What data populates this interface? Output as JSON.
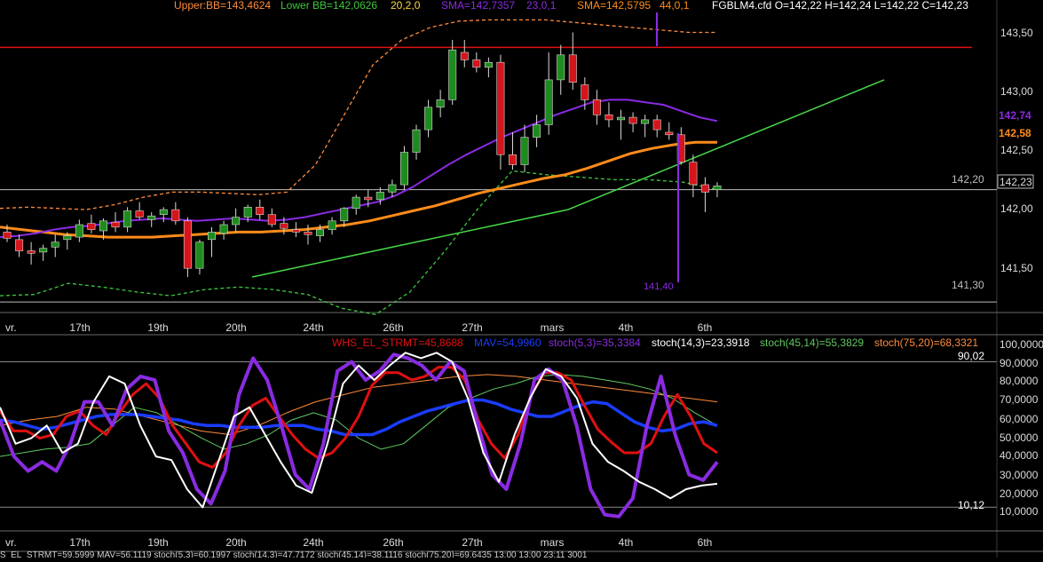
{
  "top_header": {
    "upper_bb": "Upper:BB=143,4624",
    "lower_bb": "Lower BB=142,0626",
    "bb_params": "20,2,0",
    "sma1": "SMA=142,7357",
    "sma1_params": "23,0,1",
    "sma2": "SMA=142,5795",
    "sma2_params": "44,0,1",
    "ohlc": "FGBLM4.cfd O=142,22 H=142,24 L=142,22 C=142,23"
  },
  "bottom_header": {
    "whs": "WHS_EL_STRMT=45,8688",
    "mav": "MAV=54,9960",
    "stoch1": "stoch(5,3)=35,3384",
    "stoch2": "stoch(14,3)=23,3918",
    "stoch3": "stoch(45,14)=55,3829",
    "stoch4": "stoch(75,20)=68,3321"
  },
  "price_axis": [
    "143,50",
    "143,00",
    "142,50",
    "142,00",
    "141,50"
  ],
  "price_badges": {
    "sma1_value": "142,74",
    "sma2_value": "142,58",
    "last_close": "142,23",
    "line_142_20": "142,20",
    "line_141_30": "141,30",
    "low_marker": "141,40"
  },
  "osc_axis": [
    "100,0000",
    "90,0000",
    "80,0000",
    "70,0000",
    "60,0000",
    "50,0000",
    "40,0000",
    "30,0000",
    "20,0000",
    "10,0000"
  ],
  "osc_levels": {
    "upper": "90,02",
    "lower": "10,12"
  },
  "date_axis": [
    "vr.",
    "17th",
    "19th",
    "20th",
    "24th",
    "26th",
    "27th",
    "mars",
    "4th",
    "6th"
  ],
  "footer_text": "'S_EL_STRMT=59,5999 MAV=56,1119 stoch(5,3)=60,1997 stoch(14,3)=47,7172 stoch(45,14)=38,1116 stoch(75,20)=69,6435 13:00 13:00 23:11 3001",
  "colors": {
    "bull": "#1e8b1e",
    "bear": "#d4151b",
    "sma23": "#8a2be2",
    "sma44": "#ff8c1a",
    "bb": "#ff8c3c",
    "bblower": "#3cc83c",
    "trend": "#48d848",
    "hline": "#e01010",
    "whs": "#e01010",
    "mav": "#1a3cff",
    "stoch5": "#8a2be2",
    "stoch14": "#ffffff",
    "stoch45": "#60c860",
    "stoch75": "#ff8c3c"
  },
  "chart_data": [
    {
      "type": "candlestick",
      "title": "FGBLM4.cfd",
      "ylim": [
        141.23,
        143.62
      ],
      "hlines": [
        143.34,
        142.2,
        141.3
      ],
      "candles": [
        [
          141.86,
          141.92,
          141.78,
          141.81
        ],
        [
          141.8,
          141.84,
          141.66,
          141.71
        ],
        [
          141.71,
          141.78,
          141.6,
          141.69
        ],
        [
          141.7,
          141.76,
          141.63,
          141.73
        ],
        [
          141.74,
          141.84,
          141.66,
          141.78
        ],
        [
          141.8,
          141.86,
          141.72,
          141.83
        ],
        [
          141.82,
          141.96,
          141.78,
          141.92
        ],
        [
          141.93,
          142.0,
          141.85,
          141.88
        ],
        [
          141.87,
          141.97,
          141.8,
          141.95
        ],
        [
          141.94,
          142.02,
          141.86,
          141.9
        ],
        [
          141.9,
          142.06,
          141.86,
          142.03
        ],
        [
          142.03,
          142.1,
          141.96,
          141.98
        ],
        [
          141.96,
          142.02,
          141.9,
          141.99
        ],
        [
          142.0,
          142.06,
          141.94,
          142.04
        ],
        [
          142.04,
          142.1,
          141.92,
          141.95
        ],
        [
          141.95,
          141.98,
          141.5,
          141.57
        ],
        [
          141.57,
          141.8,
          141.52,
          141.78
        ],
        [
          141.8,
          141.9,
          141.66,
          141.86
        ],
        [
          141.85,
          141.95,
          141.8,
          141.92
        ],
        [
          141.92,
          142.05,
          141.86,
          141.98
        ],
        [
          141.98,
          142.08,
          141.94,
          142.06
        ],
        [
          142.06,
          142.12,
          141.96,
          142.0
        ],
        [
          142.0,
          142.05,
          141.9,
          141.92
        ],
        [
          141.93,
          141.98,
          141.84,
          141.89
        ],
        [
          141.88,
          141.94,
          141.82,
          141.86
        ],
        [
          141.86,
          141.92,
          141.76,
          141.84
        ],
        [
          141.83,
          141.92,
          141.78,
          141.88
        ],
        [
          141.88,
          141.98,
          141.84,
          141.95
        ],
        [
          141.95,
          142.06,
          141.9,
          142.05
        ],
        [
          142.05,
          142.16,
          142.0,
          142.14
        ],
        [
          142.14,
          142.2,
          142.06,
          142.12
        ],
        [
          142.12,
          142.22,
          142.08,
          142.18
        ],
        [
          142.18,
          142.28,
          142.14,
          142.24
        ],
        [
          142.24,
          142.55,
          142.2,
          142.5
        ],
        [
          142.5,
          142.72,
          142.44,
          142.68
        ],
        [
          142.68,
          142.92,
          142.62,
          142.86
        ],
        [
          142.86,
          143.0,
          142.78,
          142.92
        ],
        [
          142.92,
          143.4,
          142.88,
          143.32
        ],
        [
          143.3,
          143.4,
          143.18,
          143.24
        ],
        [
          143.24,
          143.3,
          143.14,
          143.18
        ],
        [
          143.18,
          143.26,
          143.1,
          143.22
        ],
        [
          143.22,
          143.28,
          142.36,
          142.48
        ],
        [
          142.48,
          142.66,
          142.36,
          142.4
        ],
        [
          142.4,
          142.72,
          142.34,
          142.62
        ],
        [
          142.62,
          142.8,
          142.54,
          142.72
        ],
        [
          142.72,
          143.3,
          142.64,
          143.08
        ],
        [
          143.08,
          143.36,
          142.96,
          143.28
        ],
        [
          143.28,
          143.46,
          143.0,
          143.06
        ],
        [
          143.04,
          143.1,
          142.84,
          142.92
        ],
        [
          142.92,
          143.0,
          142.72,
          142.8
        ],
        [
          142.8,
          142.9,
          142.7,
          142.76
        ],
        [
          142.76,
          142.84,
          142.6,
          142.78
        ],
        [
          142.78,
          142.82,
          142.66,
          142.73
        ],
        [
          142.73,
          142.8,
          142.62,
          142.76
        ],
        [
          142.76,
          142.8,
          142.62,
          142.68
        ],
        [
          142.66,
          142.74,
          142.6,
          142.64
        ],
        [
          142.64,
          142.7,
          142.4,
          142.42
        ],
        [
          142.42,
          142.48,
          142.14,
          142.24
        ],
        [
          142.24,
          142.3,
          142.02,
          142.18
        ],
        [
          142.2,
          142.26,
          142.14,
          142.23
        ]
      ],
      "lines": {
        "sma23": [
          141.82,
          141.83,
          141.85,
          141.88,
          141.9,
          141.91,
          141.93,
          141.95,
          141.96,
          141.97,
          141.96,
          141.95,
          141.96,
          141.97,
          141.96,
          141.95,
          141.96,
          141.98,
          142.01,
          142.04,
          142.07,
          142.1,
          142.15,
          142.22,
          142.31,
          142.4,
          142.48,
          142.55,
          142.62,
          142.68,
          142.74,
          142.8,
          142.85,
          142.9,
          142.92,
          142.92,
          142.9,
          142.88,
          142.83,
          142.78,
          142.75
        ],
        "sma44": [
          141.9,
          141.88,
          141.86,
          141.84,
          141.83,
          141.82,
          141.82,
          141.82,
          141.83,
          141.84,
          141.85,
          141.86,
          141.86,
          141.87,
          141.88,
          141.9,
          141.92,
          141.95,
          141.99,
          142.03,
          142.07,
          142.12,
          142.17,
          142.21,
          142.25,
          142.29,
          142.32,
          142.37,
          142.43,
          142.49,
          142.53,
          142.56,
          142.58,
          142.58
        ],
        "bb_upper": [
          142.05,
          142.06,
          142.05,
          142.04,
          142.08,
          142.14,
          142.18,
          142.18,
          142.17,
          142.16,
          142.18,
          142.4,
          142.8,
          143.2,
          143.4,
          143.5,
          143.55,
          143.56,
          143.56,
          143.56,
          143.54,
          143.52,
          143.5,
          143.48,
          143.46,
          143.46
        ],
        "bb_lower": [
          141.35,
          141.36,
          141.45,
          141.42,
          141.38,
          141.35,
          141.4,
          141.42,
          141.4,
          141.36,
          141.25,
          141.2,
          141.38,
          141.7,
          142.05,
          142.35,
          142.32,
          142.3,
          142.28,
          142.28,
          142.26,
          142.2
        ],
        "trend": [
          141.5,
          142.04,
          143.08
        ]
      }
    },
    {
      "type": "line",
      "title": "Oscillators",
      "ylim": [
        0,
        100
      ],
      "levels": [
        90.02,
        10.12
      ],
      "series": [
        {
          "name": "WHS_EL_STRMT",
          "values": [
            63,
            52,
            52,
            48,
            50,
            60,
            63,
            55,
            50,
            62,
            72,
            78,
            70,
            55,
            45,
            35,
            32,
            40,
            55,
            66,
            70,
            60,
            50,
            42,
            37,
            40,
            48,
            60,
            77,
            84,
            84,
            80,
            82,
            87,
            87,
            80,
            58,
            45,
            37,
            50,
            72,
            84,
            84,
            80,
            66,
            53,
            46,
            40,
            40,
            45,
            60,
            72,
            60,
            45,
            40
          ]
        },
        {
          "name": "MAV",
          "values": [
            58,
            57,
            55,
            53,
            54,
            56,
            58,
            60,
            61,
            61,
            61,
            60,
            59,
            58,
            56,
            55,
            55,
            54,
            54,
            54,
            55,
            55,
            55,
            53,
            52,
            50,
            50,
            50,
            53,
            57,
            60,
            63,
            65,
            67,
            69,
            69,
            67,
            64,
            62,
            60,
            60,
            63,
            66,
            68,
            67,
            62,
            57,
            54,
            52,
            53,
            56,
            57,
            55
          ]
        },
        {
          "name": "stoch(5,3)",
          "values": [
            58,
            38,
            30,
            35,
            30,
            45,
            68,
            68,
            55,
            75,
            82,
            80,
            52,
            40,
            20,
            12,
            30,
            72,
            92,
            80,
            55,
            28,
            20,
            45,
            85,
            90,
            80,
            85,
            94,
            92,
            88,
            80,
            90,
            85,
            55,
            28,
            20,
            45,
            80,
            86,
            80,
            55,
            20,
            6,
            5,
            15,
            55,
            82,
            50,
            28,
            25,
            35
          ]
        },
        {
          "name": "stoch(14,3)",
          "values": [
            65,
            45,
            48,
            55,
            40,
            45,
            68,
            82,
            78,
            55,
            38,
            36,
            20,
            10,
            35,
            60,
            65,
            50,
            35,
            22,
            18,
            45,
            78,
            88,
            80,
            88,
            95,
            92,
            95,
            90,
            70,
            40,
            24,
            50,
            70,
            86,
            82,
            70,
            45,
            35,
            30,
            24,
            20,
            15,
            20,
            22,
            23
          ]
        },
        {
          "name": "stoch(45,14)",
          "values": [
            38,
            40,
            42,
            43,
            45,
            55,
            65,
            62,
            55,
            48,
            42,
            45,
            50,
            58,
            62,
            58,
            48,
            42,
            45,
            55,
            65,
            70,
            75,
            78,
            82,
            83,
            82,
            80,
            78,
            75,
            70,
            62,
            55
          ]
        },
        {
          "name": "stoch(75,20)",
          "values": [
            55,
            58,
            60,
            65,
            64,
            60,
            56,
            52,
            50,
            55,
            62,
            68,
            72,
            76,
            78,
            80,
            82,
            83,
            82,
            80,
            78,
            76,
            74,
            72,
            70,
            68
          ]
        }
      ]
    }
  ]
}
